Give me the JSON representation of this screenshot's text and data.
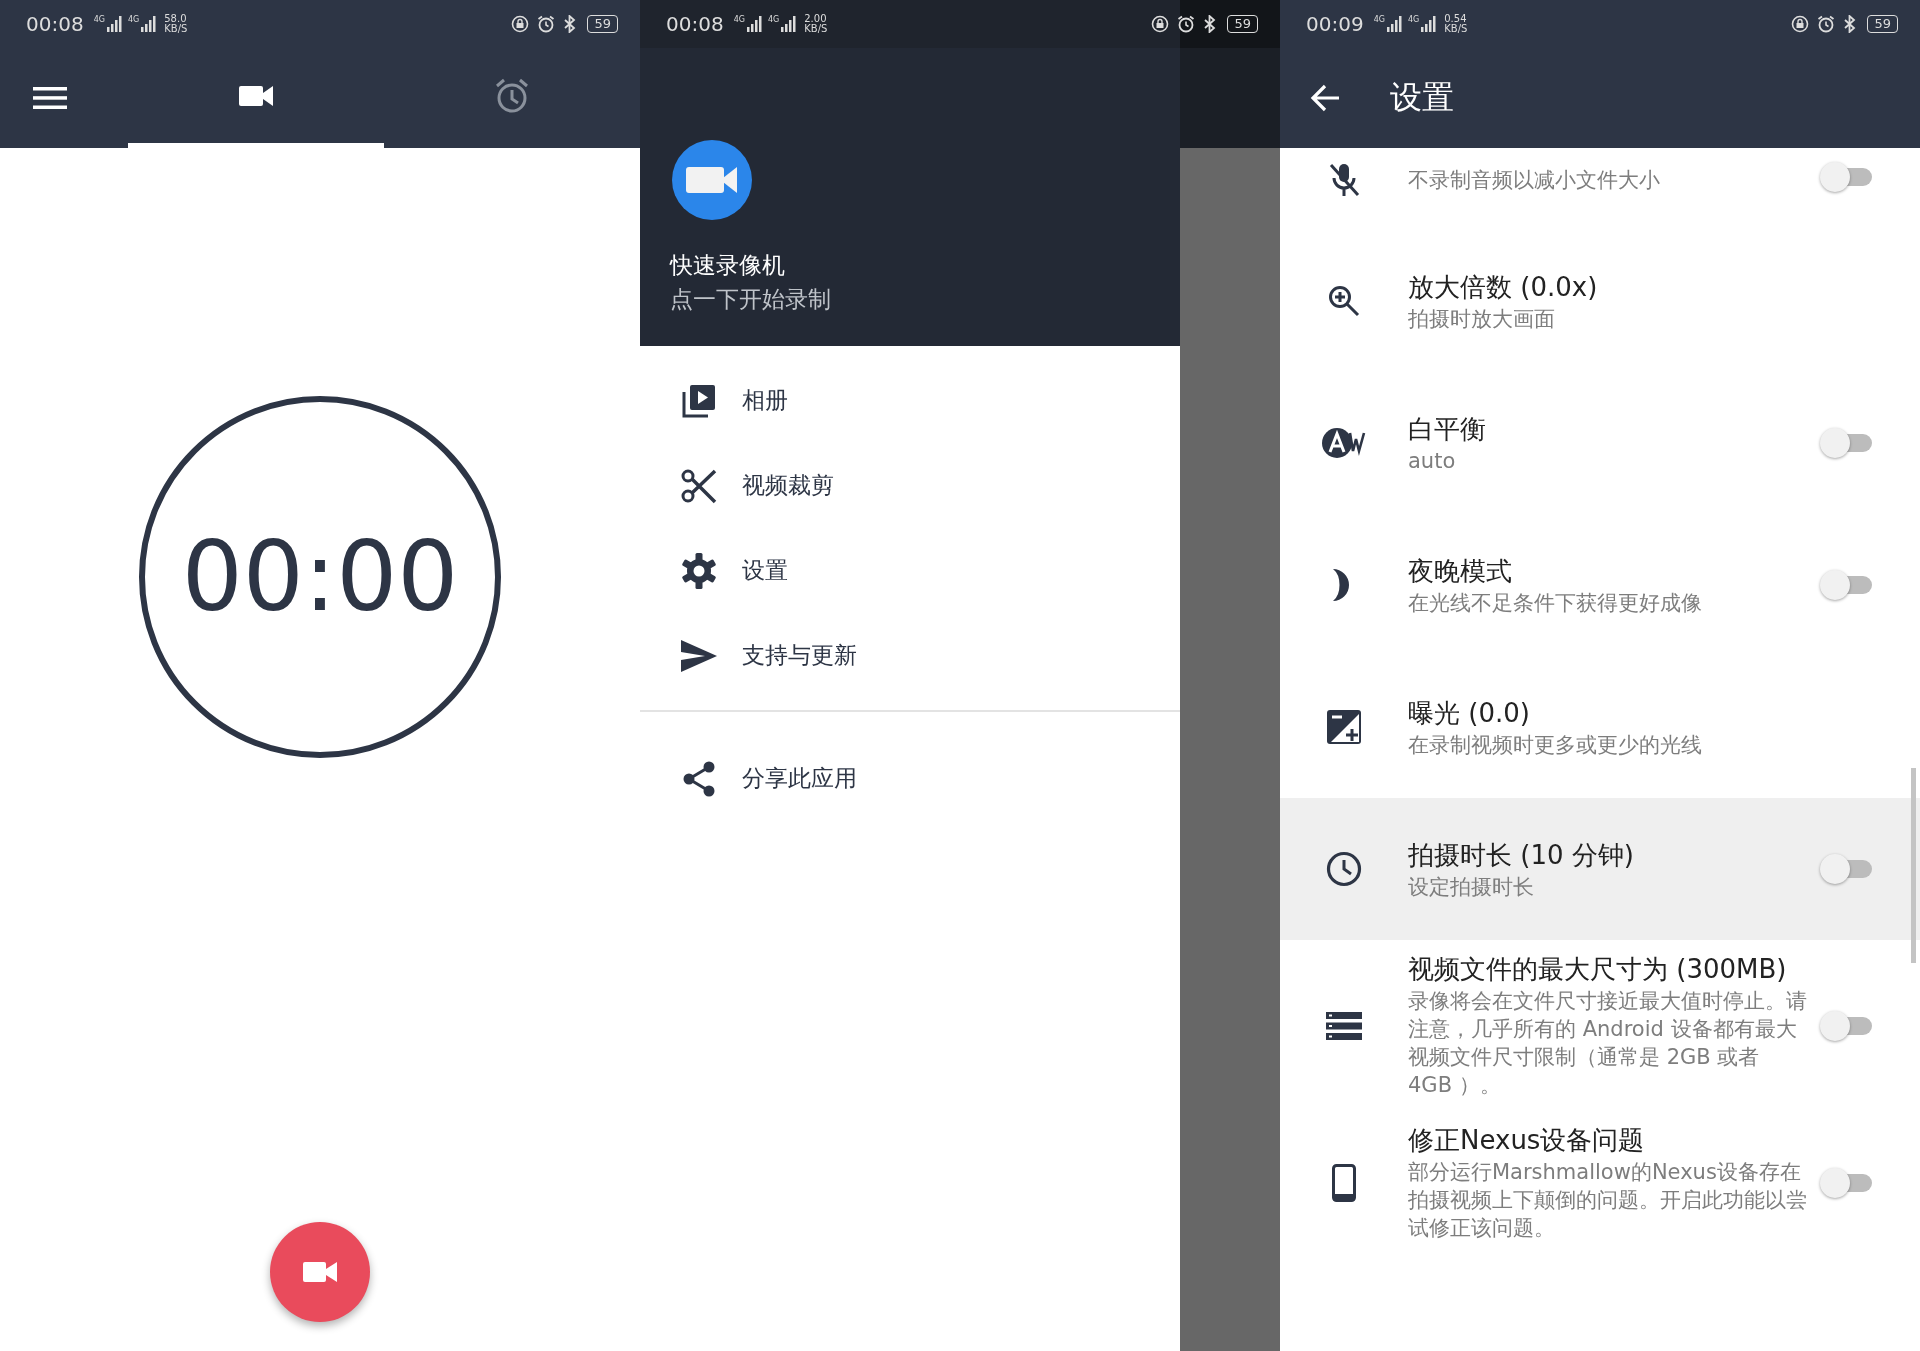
{
  "status_bars": [
    {
      "time": "00:08",
      "network": [
        "4G",
        "4G"
      ],
      "speed": "58.0",
      "speed_unit": "KB/S",
      "battery": "59"
    },
    {
      "time": "00:08",
      "network": [
        "4G",
        "4G"
      ],
      "speed": "2.00",
      "speed_unit": "KB/S",
      "battery": "59"
    },
    {
      "time": "00:09",
      "network": [
        "4G",
        "4G"
      ],
      "speed": "0.54",
      "speed_unit": "KB/S",
      "battery": "59"
    }
  ],
  "recorder": {
    "tabs": [
      {
        "selected": true
      },
      {
        "selected": false
      }
    ],
    "timer": "00:00"
  },
  "drawer": {
    "app_name": "快速录像机",
    "app_subtitle": "点一下开始录制",
    "items": [
      {
        "label": "相册"
      },
      {
        "label": "视频裁剪"
      },
      {
        "label": "设置"
      },
      {
        "label": "支持与更新"
      },
      {
        "label": "分享此应用"
      }
    ]
  },
  "settings": {
    "title": "设置",
    "items": [
      {
        "subtitle": "不录制音频以减小文件大小",
        "kind": "switch",
        "checked": false,
        "highlighted": false
      },
      {
        "title": "放大倍数 (0.0x)",
        "subtitle": "拍摄时放大画面",
        "kind": "plain",
        "highlighted": false
      },
      {
        "title": "白平衡",
        "subtitle": "auto",
        "kind": "switch",
        "checked": false,
        "highlighted": false
      },
      {
        "title": "夜晚模式",
        "subtitle": "在光线不足条件下获得更好成像",
        "kind": "switch",
        "checked": false,
        "highlighted": false
      },
      {
        "title": "曝光 (0.0)",
        "subtitle": "在录制视频时更多或更少的光线",
        "kind": "plain",
        "highlighted": false
      },
      {
        "title": "拍摄时长 (10 分钟)",
        "subtitle": "设定拍摄时长",
        "kind": "switch",
        "checked": false,
        "highlighted": true
      },
      {
        "title": "视频文件的最大尺寸为 (300MB)",
        "subtitle": "录像将会在文件尺寸接近最大值时停止。请注意，几乎所有的 Android 设备都有最大视频文件尺寸限制（通常是 2GB 或者 4GB ）。",
        "kind": "switch",
        "checked": false,
        "highlighted": false
      },
      {
        "title": "修正Nexus设备问题",
        "subtitle": "部分运行Marshmallow的Nexus设备存在拍摄视频上下颠倒的问题。开启此功能以尝试修正该问题。",
        "kind": "switch",
        "checked": false,
        "highlighted": false
      }
    ]
  }
}
